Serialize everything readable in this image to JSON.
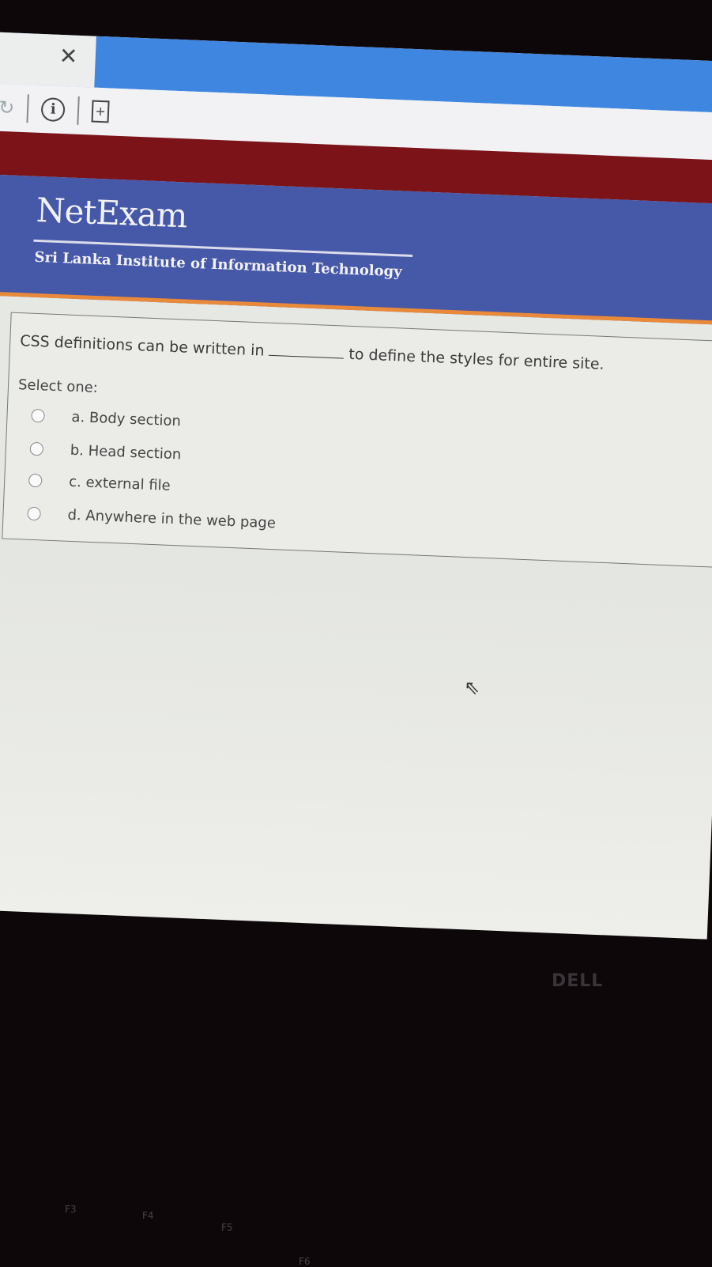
{
  "browser": {
    "close_tab_icon": "close-icon",
    "reload_icon": "reload-icon",
    "info_icon": "info-icon",
    "page_icon": "new-page-icon"
  },
  "header": {
    "logo": "NetExam",
    "institute": "Sri Lanka Institute of Information Technology"
  },
  "question": {
    "text_before": "CSS definitions can be written in",
    "text_after": "to define the styles for entire site.",
    "prompt": "Select one:",
    "options": [
      {
        "label": "a. Body section",
        "selected": false
      },
      {
        "label": "b. Head section",
        "selected": false
      },
      {
        "label": "c. external file",
        "selected": false
      },
      {
        "label": "d. Anywhere in the web page",
        "selected": false
      }
    ]
  },
  "laptop": {
    "brand": "DELL",
    "keys": [
      "F3",
      "F4",
      "F5",
      "F6"
    ]
  },
  "colors": {
    "header_blue": "#4658a8",
    "top_band": "#7b1318",
    "accent_orange": "#e98a3a",
    "tab_blue": "#3f86e0"
  }
}
